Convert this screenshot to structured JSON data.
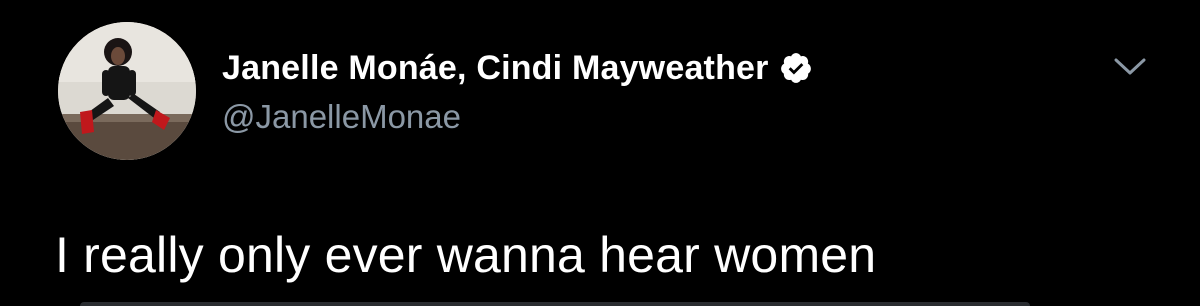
{
  "tweet": {
    "author": {
      "display_name": "Janelle Monáe, Cindi Mayweather",
      "handle": "@JanelleMonae",
      "verified": true,
      "avatar": "profile-photo"
    },
    "menu_icon": "chevron-down-icon",
    "text": "I really only ever wanna hear women"
  },
  "colors": {
    "background": "#000000",
    "primary_text": "#ffffff",
    "secondary_text": "#8b98a5",
    "verified_badge": "#ffffff"
  }
}
